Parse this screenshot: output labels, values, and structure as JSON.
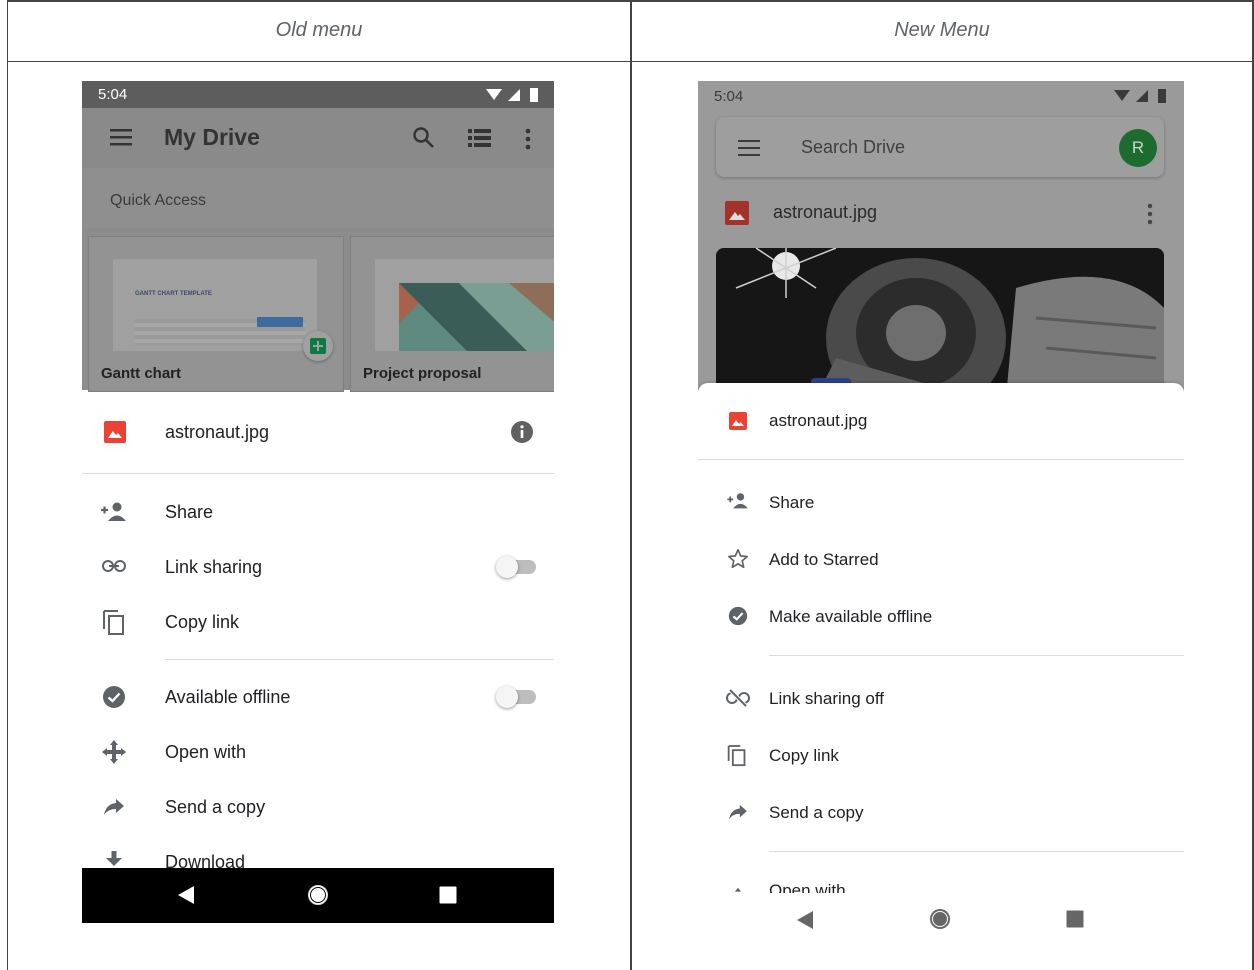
{
  "columns": {
    "left_title": "Old menu",
    "right_title": "New Menu"
  },
  "old": {
    "status_time": "5:04",
    "title": "My Drive",
    "quick_access": "Quick Access",
    "cards": [
      {
        "name": "Gantt chart",
        "thumb_text": "GANTT CHART TEMPLATE"
      },
      {
        "name": "Project proposal"
      }
    ],
    "file_name": "astronaut.jpg",
    "items": [
      {
        "label": "Share",
        "icon": "person-add-icon"
      },
      {
        "label": "Link sharing",
        "icon": "link-icon",
        "toggle": false
      },
      {
        "label": "Copy link",
        "icon": "copy-icon"
      },
      {
        "label": "Available offline",
        "icon": "offline-check-icon",
        "toggle": false
      },
      {
        "label": "Open with",
        "icon": "open-with-icon"
      },
      {
        "label": "Send a copy",
        "icon": "send-icon"
      },
      {
        "label": "Download",
        "icon": "download-icon"
      }
    ]
  },
  "new": {
    "status_time": "5:04",
    "search_placeholder": "Search Drive",
    "avatar_letter": "R",
    "avatar_color": "#1e8e3e",
    "file_name": "astronaut.jpg",
    "sheet_file_name": "astronaut.jpg",
    "items": [
      {
        "label": "Share",
        "icon": "person-add-icon"
      },
      {
        "label": "Add to Starred",
        "icon": "star-outline-icon"
      },
      {
        "label": "Make available offline",
        "icon": "offline-check-icon"
      },
      {
        "label": "Link sharing off",
        "icon": "link-off-icon"
      },
      {
        "label": "Copy link",
        "icon": "copy-icon"
      },
      {
        "label": "Send a copy",
        "icon": "send-icon"
      },
      {
        "label": "Open with",
        "icon": "open-with-icon"
      }
    ]
  },
  "colors": {
    "image_red": "#ea4335",
    "sheets_green": "#0f9d58"
  }
}
